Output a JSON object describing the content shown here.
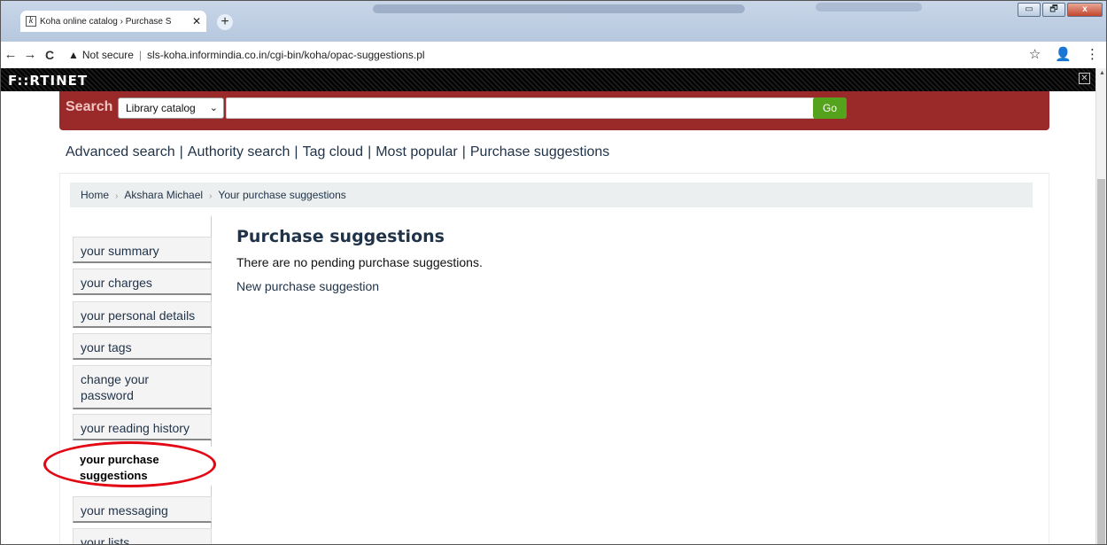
{
  "browser": {
    "tab_title": "Koha online catalog › Purchase S",
    "tab_close": "✕",
    "favicon": "k",
    "new_tab": "+",
    "window_buttons": [
      "▭",
      "🗗",
      "x"
    ],
    "back": "←",
    "forward": "→",
    "reload": "C",
    "security_icon": "▲",
    "security_text": "Not secure",
    "url": "sls-koha.informindia.co.in/cgi-bin/koha/opac-suggestions.pl",
    "bookmark_icon": "☆",
    "profile_icon": "👤",
    "menu_icon": "⋮"
  },
  "fortinet": {
    "logo_text": "F::RTINET",
    "close": "✕"
  },
  "search": {
    "label": "Search",
    "scope": "Library catalog",
    "query": "",
    "go": "Go"
  },
  "links": [
    "Advanced search",
    "Authority search",
    "Tag cloud",
    "Most popular",
    "Purchase suggestions"
  ],
  "breadcrumb": [
    "Home",
    "Akshara Michael",
    "Your purchase suggestions"
  ],
  "sidebar": [
    {
      "label": "your summary"
    },
    {
      "label": "your charges"
    },
    {
      "label": "your personal details"
    },
    {
      "label": "your tags"
    },
    {
      "label": "change your password"
    },
    {
      "label": "your reading history"
    },
    {
      "label": "your purchase suggestions",
      "active": true
    },
    {
      "label": "your messaging"
    },
    {
      "label": "your lists"
    }
  ],
  "main": {
    "title": "Purchase suggestions",
    "message": "There are no pending purchase suggestions.",
    "new_link": "New purchase suggestion"
  },
  "colors": {
    "search_bar": "#9a2a29",
    "go_button": "#55a31d",
    "annotation": "#e30613",
    "link_text": "#1f3248"
  }
}
